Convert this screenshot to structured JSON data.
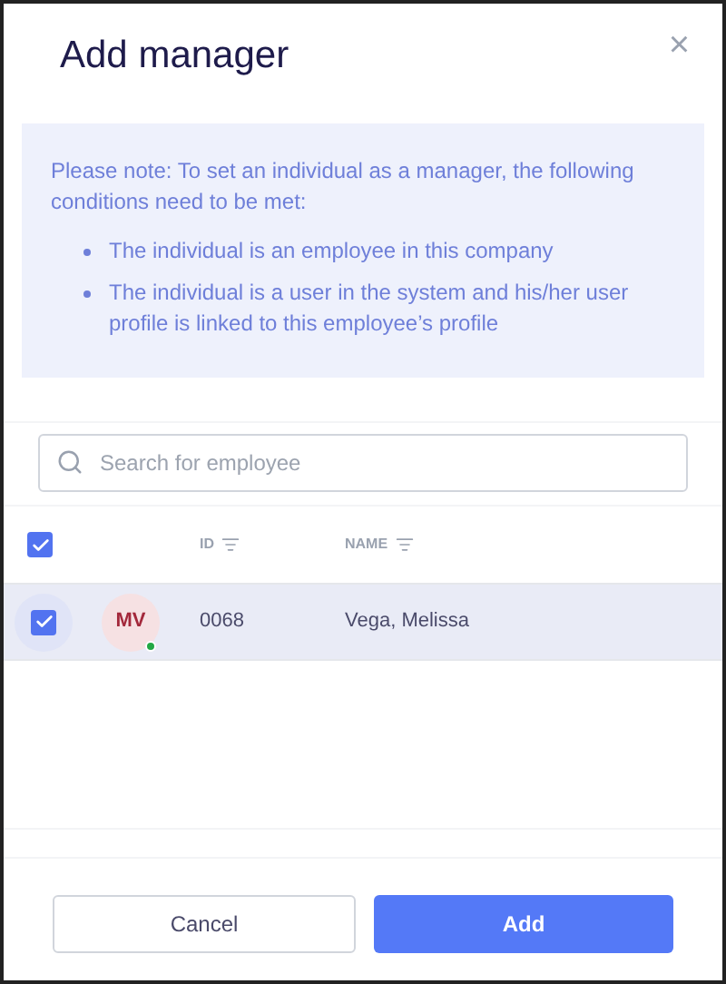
{
  "dialog": {
    "title": "Add manager",
    "close": "×"
  },
  "note": {
    "intro": "Please note: To set an individual as a manager, the following conditions need to be met:",
    "conditions": [
      "The individual is an employee in this company",
      "The individual is a user in the system and his/her user profile is linked to this employee’s profile"
    ]
  },
  "search": {
    "placeholder": "Search for employee"
  },
  "table": {
    "all_checked": true,
    "columns": [
      "ID",
      "NAME"
    ],
    "rows": [
      {
        "checked": true,
        "selected": true,
        "initials": "MV",
        "online": true,
        "id": "0068",
        "name": "Vega, Melissa"
      }
    ]
  },
  "buttons": [
    {
      "kind": "secondary",
      "label": "Cancel"
    },
    {
      "kind": "primary",
      "label": "Add"
    }
  ]
}
